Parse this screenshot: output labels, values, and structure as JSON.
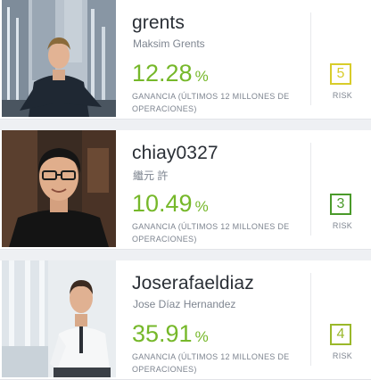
{
  "traders": [
    {
      "username": "grents",
      "real_name": "Maksim Grents",
      "gain_value": "12.28",
      "gain_unit": "%",
      "gain_label": "GANANCIA (ÚLTIMOS 12 MILLONES DE OPERACIONES)",
      "risk_score": "5",
      "risk_label": "RISK",
      "risk_color": "#d8cc2a"
    },
    {
      "username": "chiay0327",
      "real_name": "繼元 許",
      "gain_value": "10.49",
      "gain_unit": "%",
      "gain_label": "GANANCIA (ÚLTIMOS 12 MILLONES DE OPERACIONES)",
      "risk_score": "3",
      "risk_label": "RISK",
      "risk_color": "#4a9a2a"
    },
    {
      "username": "Joserafaeldiaz",
      "real_name": "Jose Díaz Hernandez",
      "gain_value": "35.91",
      "gain_unit": "%",
      "gain_label": "GANANCIA (ÚLTIMOS 12 MILLONES DE OPERACIONES)",
      "risk_score": "4",
      "risk_label": "RISK",
      "risk_color": "#9ab82a"
    }
  ],
  "colors": {
    "gain_green": "#76b82a",
    "username_text": "#2a2f36",
    "secondary_text": "#7e8590"
  }
}
